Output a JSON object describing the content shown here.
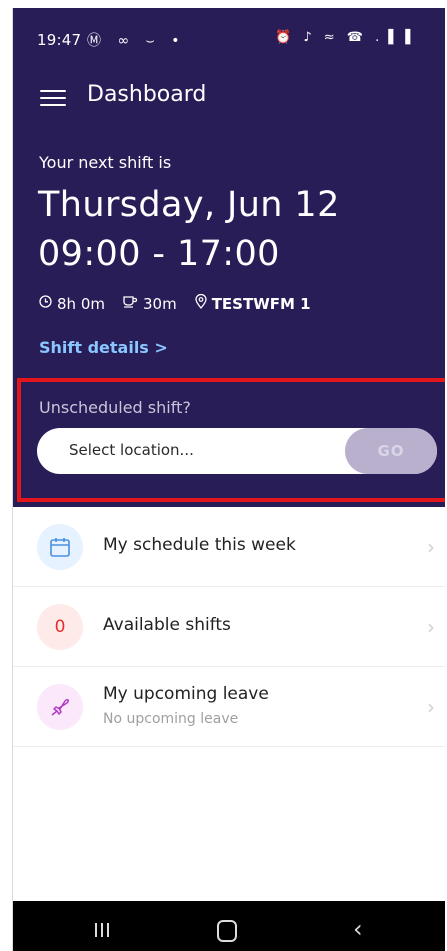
{
  "status_bar": {
    "time": "19:47",
    "left_icons": "Ⓜ ∞ ⌣ •",
    "right_icons": "⏰ ♪ ≈ ☎ .▐ ▌"
  },
  "header": {
    "title": "Dashboard",
    "menu_icon": "hamburger-icon"
  },
  "next_shift": {
    "label": "Your next shift is",
    "date": "Thursday, Jun 12",
    "time_range": "09:00 - 17:00",
    "duration": "8h 0m",
    "break": "30m",
    "location": "TESTWFM 1",
    "details_link": "Shift details >"
  },
  "unscheduled": {
    "label": "Unscheduled shift?",
    "placeholder": "Select location...",
    "go_label": "GO"
  },
  "list": [
    {
      "title": "My schedule this week",
      "icon": "calendar-icon",
      "color": "#e6f2ff"
    },
    {
      "title": "Available shifts",
      "badge": "0",
      "color": "#ffeaea"
    },
    {
      "title": "My upcoming leave",
      "subtitle": "No upcoming leave",
      "icon": "plane-icon",
      "color": "#fbe8fb"
    }
  ],
  "colors": {
    "hero_bg": "#291d57",
    "link": "#8ac6ff",
    "highlight": "#e3161c",
    "go_bg": "#b8b0cc"
  }
}
